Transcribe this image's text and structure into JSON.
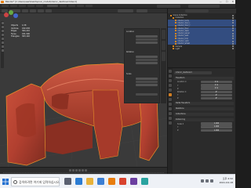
{
  "window": {
    "title": "Blender* [C:\\Users\\user\\Desktop\\car_model\\interior_dashboard.blend]",
    "controls": [
      "—",
      "☐",
      "✕"
    ]
  },
  "stats": [
    {
      "label": "Objects",
      "value": "1/18"
    },
    {
      "label": "Vertices",
      "value": "182,638"
    },
    {
      "label": "Edges",
      "value": "364,210"
    },
    {
      "label": "Faces",
      "value": "181,596"
    },
    {
      "label": "Triangles",
      "value": "363,192"
    }
  ],
  "n_panel": {
    "sections": [
      "Location",
      "Rotation",
      "Scale"
    ]
  },
  "outliner": {
    "rows": [
      {
        "label": "Scene Collection",
        "selected": false,
        "indent": 0
      },
      {
        "label": "Collection",
        "selected": false,
        "indent": 1
      },
      {
        "label": "interior_body",
        "selected": true,
        "indent": 2
      },
      {
        "label": "interior_door_l",
        "selected": true,
        "indent": 2
      },
      {
        "label": "interior_door_r",
        "selected": true,
        "indent": 2
      },
      {
        "label": "interior_floor",
        "selected": true,
        "indent": 2
      },
      {
        "label": "interior_dash",
        "selected": true,
        "indent": 2
      },
      {
        "label": "interior_panel",
        "selected": true,
        "indent": 2
      },
      {
        "label": "interior_seat",
        "selected": true,
        "indent": 2
      },
      {
        "label": "interior_trim",
        "selected": true,
        "indent": 2
      },
      {
        "label": "interior_vent",
        "selected": true,
        "indent": 2
      },
      {
        "label": "interior_wheel",
        "selected": true,
        "indent": 2
      },
      {
        "label": "Camera",
        "selected": false,
        "indent": 1
      },
      {
        "label": "Light",
        "selected": false,
        "indent": 1
      }
    ]
  },
  "properties": {
    "object_name": "interior_dashboard",
    "sections": [
      {
        "title": "Transform",
        "fields": [
          {
            "label": "Location X",
            "value": "0 m"
          },
          {
            "label": "Y",
            "value": "0 m"
          },
          {
            "label": "Z",
            "value": "0 m"
          },
          {
            "label": "Rotation X",
            "value": "0°"
          },
          {
            "label": "Y",
            "value": "0°"
          },
          {
            "label": "Z",
            "value": "0°"
          }
        ]
      },
      {
        "title": "Delta Transform",
        "fields": []
      },
      {
        "title": "Relations",
        "fields": []
      },
      {
        "title": "Collections",
        "fields": []
      },
      {
        "title": "Instancing",
        "fields": [
          {
            "label": "Scale X",
            "value": "1.000"
          },
          {
            "label": "Y",
            "value": "1.000"
          },
          {
            "label": "Z",
            "value": "1.000"
          }
        ]
      }
    ]
  },
  "taskbar": {
    "search_placeholder": "검색하려면 여기에 입력하십시오.",
    "time": "오후 4:32",
    "date": "2021-04-18"
  },
  "colors": {
    "mesh": "#b5412a",
    "selection_outline": "#e8902a",
    "selection_row": "#334d80",
    "accent": "#e87d0d"
  }
}
